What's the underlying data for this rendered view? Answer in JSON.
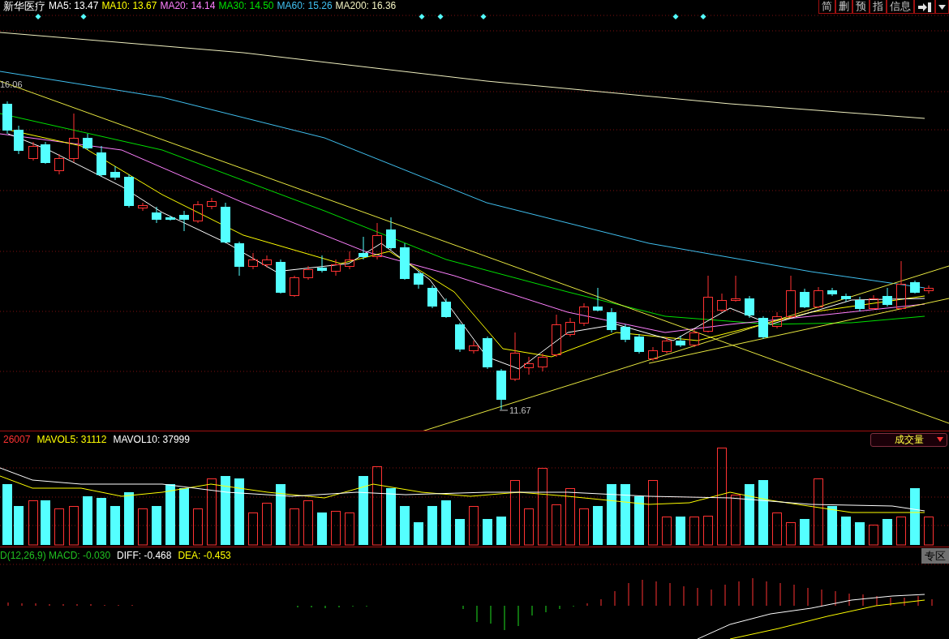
{
  "header": {
    "stock_name": "新华医疗",
    "indicators": [
      {
        "label": "MA5: 13.47",
        "color": "#ffffff"
      },
      {
        "label": "MA10: 13.67",
        "color": "#ffff00"
      },
      {
        "label": "MA20: 14.14",
        "color": "#ff80ff"
      },
      {
        "label": "MA30: 14.50",
        "color": "#00e000"
      },
      {
        "label": "MA60: 15.26",
        "color": "#40c0f0"
      },
      {
        "label": "MA200: 16.36",
        "color": "#f0f0c0"
      }
    ],
    "toolbar": [
      {
        "kind": "text",
        "label": "简"
      },
      {
        "kind": "text",
        "label": "删"
      },
      {
        "kind": "text",
        "label": "预"
      },
      {
        "kind": "text",
        "label": "指"
      },
      {
        "kind": "text",
        "label": "信息"
      },
      {
        "kind": "exit"
      },
      {
        "kind": "dropdown"
      }
    ]
  },
  "price_chart": {
    "high_label": "16.06",
    "low_label": "11.67"
  },
  "volume": {
    "indicators": [
      {
        "label": "26007",
        "color": "#ff3232"
      },
      {
        "label": "MAVOL5: 31112",
        "color": "#ffff00"
      },
      {
        "label": "MAVOL10: 37999",
        "color": "#ffffff"
      }
    ],
    "selector": {
      "label": "成交量"
    }
  },
  "macd": {
    "indicators": [
      {
        "label": "D(12,26,9) MACD: -0.030",
        "color": "#20c020"
      },
      {
        "label": "DIFF: -0.468",
        "color": "#ffffff"
      },
      {
        "label": "DEA: -0.453",
        "color": "#ffff00"
      }
    ],
    "zone_button": "专区"
  }
}
